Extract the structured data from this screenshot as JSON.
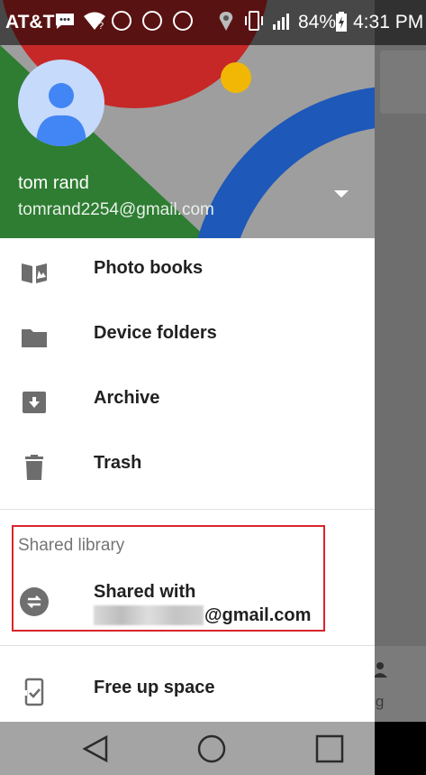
{
  "status_bar": {
    "carrier": "AT&T",
    "battery": "84%",
    "time": "4:31 PM"
  },
  "account": {
    "name": "tom rand",
    "email": "tomrand2254@gmail.com"
  },
  "menu": [
    {
      "label": "Photo books",
      "icon": "photo-book-icon"
    },
    {
      "label": "Device folders",
      "icon": "folder-icon"
    },
    {
      "label": "Archive",
      "icon": "archive-icon"
    },
    {
      "label": "Trash",
      "icon": "trash-icon"
    }
  ],
  "shared_library": {
    "title": "Shared library",
    "item_label": "Shared with",
    "email_domain": "@gmail.com"
  },
  "bottom_item": {
    "label": "Free up space",
    "icon": "free-up-space-icon"
  },
  "background_app": {
    "tab_label_partial": "ring"
  },
  "colors": {
    "header_red": "#c62828",
    "header_green": "#2e7d32",
    "header_blue": "#1e58b8",
    "header_yellow": "#f2b705",
    "highlight_border": "#d8252b",
    "avatar_blue": "#4285f4"
  }
}
